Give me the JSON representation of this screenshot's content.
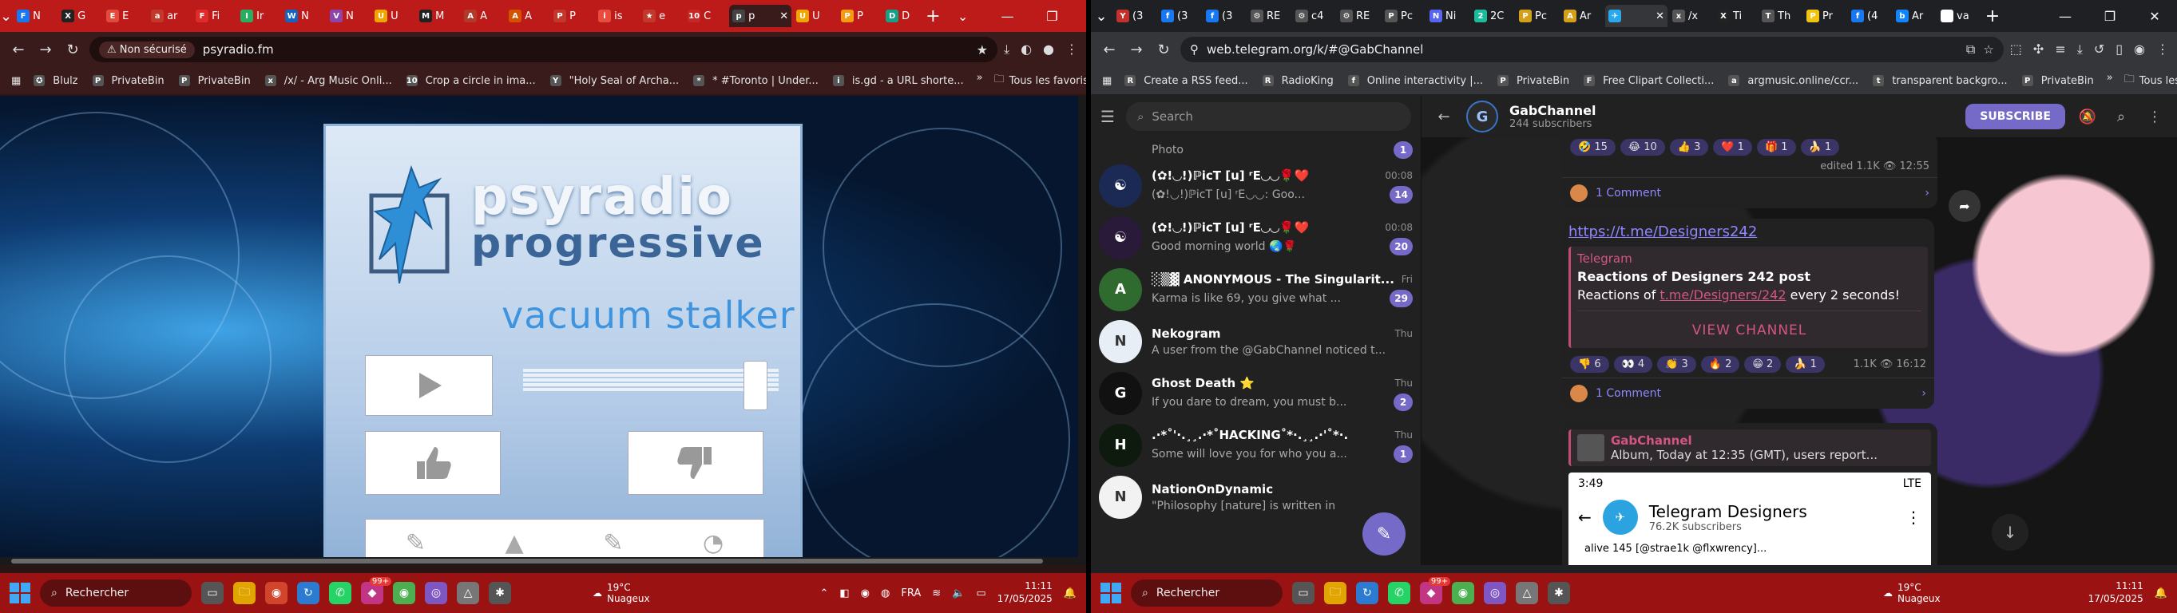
{
  "left": {
    "tabs": [
      {
        "label": "N",
        "fav": "F",
        "color": "#1877f2"
      },
      {
        "label": "G",
        "fav": "X",
        "color": "#222"
      },
      {
        "label": "E",
        "fav": "E",
        "color": "#e24a3b"
      },
      {
        "label": "ar",
        "fav": "a",
        "color": "#c0392b"
      },
      {
        "label": "Fi",
        "fav": "F",
        "color": "#e02b2b"
      },
      {
        "label": "Ir",
        "fav": "I",
        "color": "#27ae60"
      },
      {
        "label": "N",
        "fav": "W",
        "color": "#1565c0"
      },
      {
        "label": "N",
        "fav": "V",
        "color": "#8e44ad"
      },
      {
        "label": "U",
        "fav": "U",
        "color": "#f1a500"
      },
      {
        "label": "M",
        "fav": "M",
        "color": "#222"
      },
      {
        "label": "A",
        "fav": "A",
        "color": "#b23a2b"
      },
      {
        "label": "A",
        "fav": "A",
        "color": "#d35400"
      },
      {
        "label": "P",
        "fav": "P",
        "color": "#c0392b"
      },
      {
        "label": "is",
        "fav": "i",
        "color": "#e74c3c"
      },
      {
        "label": "e",
        "fav": "★",
        "color": "#c0392b"
      },
      {
        "label": "C",
        "fav": "10",
        "color": "#c62828"
      },
      {
        "label": "p",
        "fav": "p",
        "color": "#444"
      },
      {
        "label": "U",
        "fav": "U",
        "color": "#f1a500"
      },
      {
        "label": "P",
        "fav": "P",
        "color": "#f39c12"
      },
      {
        "label": "D",
        "fav": "D",
        "color": "#16a085"
      }
    ],
    "address": {
      "security": "Non sécurisé",
      "url": "psyradio.fm"
    },
    "bookmarks": [
      {
        "label": "Blulz",
        "fav": "✪"
      },
      {
        "label": "PrivateBin",
        "fav": "P"
      },
      {
        "label": "PrivateBin",
        "fav": "P"
      },
      {
        "label": "/x/ - Arg Music Onli...",
        "fav": "x"
      },
      {
        "label": "Crop a circle in ima...",
        "fav": "10"
      },
      {
        "label": "\"Holy Seal of Archa...",
        "fav": "Y"
      },
      {
        "label": "* #Toronto | Under...",
        "fav": "*"
      },
      {
        "label": "is.gd - a URL shorte...",
        "fav": "i"
      }
    ],
    "bookmarks_more": "»",
    "bookmarks_all": "Tous les favoris",
    "page": {
      "title1": "psyradio",
      "title2": "progressive",
      "track": "vacuum stalker",
      "volume_level": 0.95
    }
  },
  "right": {
    "tabs": [
      {
        "label": "(3",
        "fav": "Y",
        "color": "#c4302b"
      },
      {
        "label": "(3",
        "fav": "f",
        "color": "#1877f2"
      },
      {
        "label": "(3",
        "fav": "f",
        "color": "#1877f2"
      },
      {
        "label": "RE",
        "fav": "⚙",
        "color": "#555"
      },
      {
        "label": "c4",
        "fav": "⚙",
        "color": "#555"
      },
      {
        "label": "RE",
        "fav": "⚙",
        "color": "#555"
      },
      {
        "label": "Pc",
        "fav": "P",
        "color": "#555"
      },
      {
        "label": "Ni",
        "fav": "N",
        "color": "#5865f2"
      },
      {
        "label": "2C",
        "fav": "2",
        "color": "#1abc9c"
      },
      {
        "label": "Pc",
        "fav": "P",
        "color": "#d4a017"
      },
      {
        "label": "Ar",
        "fav": "A",
        "color": "#d4a017"
      },
      {
        "label": "",
        "fav": "✈",
        "color": "#29a9eb"
      },
      {
        "label": "/x",
        "fav": "x",
        "color": "#555"
      },
      {
        "label": "Ti",
        "fav": "X",
        "color": "#222"
      },
      {
        "label": "Th",
        "fav": "T",
        "color": "#555"
      },
      {
        "label": "Pr",
        "fav": "P",
        "color": "#f1c40f"
      },
      {
        "label": "(4",
        "fav": "f",
        "color": "#1877f2"
      },
      {
        "label": "Ar",
        "fav": "b",
        "color": "#1185fe"
      },
      {
        "label": "va",
        "fav": "G",
        "color": "#fff"
      }
    ],
    "address": {
      "url": "web.telegram.org/k/#@GabChannel"
    },
    "bookmarks": [
      {
        "label": "Create a RSS feed...",
        "fav": "R"
      },
      {
        "label": "RadioKing",
        "fav": "R"
      },
      {
        "label": "Online interactivity |...",
        "fav": "f"
      },
      {
        "label": "PrivateBin",
        "fav": "P"
      },
      {
        "label": "Free Clipart Collecti...",
        "fav": "F"
      },
      {
        "label": "argmusic.online/ccr...",
        "fav": "a"
      },
      {
        "label": "transparent backgro...",
        "fav": "t"
      },
      {
        "label": "PrivateBin",
        "fav": "P"
      }
    ],
    "bookmarks_more": "»",
    "bookmarks_all": "Tous les favoris",
    "telegram": {
      "search_placeholder": "Search",
      "chats": [
        {
          "name": "",
          "time": "",
          "msg": "Photo",
          "badge": "1",
          "avatar_color": "#6a4a2a",
          "short": true
        },
        {
          "name": "(✿!◡!)ℙicT [u] ʳE◡◡🌹❤️",
          "time": "00:08",
          "msg": "(✿!◡!)ℙicT [u] ʳE◡◡: Goo...",
          "badge": "14",
          "avatar_color": "#1a2a55",
          "initial": "☯"
        },
        {
          "name": "(✿!◡!)ℙicT [u] ʳE◡◡🌹❤️",
          "time": "00:08",
          "msg": "Good morning world 🌏🌹",
          "badge": "20",
          "avatar_color": "#2a1a3a",
          "initial": "☯"
        },
        {
          "name": "░▒▓ ANONYMOUS - The Singularit...",
          "time": "Fri",
          "msg": "Karma is like 69, you give what ...",
          "badge": "29",
          "avatar_color": "#2f6b2f",
          "initial": "A"
        },
        {
          "name": "Nekogram",
          "time": "Thu",
          "msg": "A user from the @GabChannel noticed t...",
          "badge": "",
          "avatar_color": "#e8eef6",
          "initial": "N"
        },
        {
          "name": "Ghost Death ⭐",
          "time": "Thu",
          "msg": "If you dare to dream, you must b...",
          "badge": "2",
          "avatar_color": "#111",
          "initial": "G"
        },
        {
          "name": ".·*˚'·.¸¸.·*˚HACKING˚*·.¸¸.·'˚*·.",
          "time": "Thu",
          "msg": "Some will love you for who you a...",
          "badge": "1",
          "avatar_color": "#0f1a0f",
          "initial": "H"
        },
        {
          "name": "NationOnDynamic",
          "time": "",
          "msg": "\"Philosophy [nature] is written in",
          "badge": "",
          "avatar_color": "#f2f2f2",
          "initial": "N"
        }
      ],
      "channel": {
        "title": "GabChannel",
        "subscribers": "244 subscribers",
        "subscribe_label": "SUBSCRIBE"
      },
      "msg1": {
        "reactions": [
          "🤣 15",
          "😂 10",
          "👍 3",
          "❤️ 1",
          "🎁 1",
          "🍌 1"
        ],
        "meta": "edited 1.1K 👁 12:55",
        "comments": "1 Comment"
      },
      "msg2": {
        "link": "https://t.me/Designers242",
        "site": "Telegram",
        "pv_title": "Reactions of Designers 242 post",
        "pv_desc_prefix": "Reactions of ",
        "pv_desc_link": "t.me/Designers/242",
        "pv_desc_suffix": " every 2 seconds!",
        "view_channel": "VIEW CHANNEL",
        "reactions": [
          "👎 6",
          "👀 4",
          "👏 3",
          "🔥 2",
          "😁 2",
          "🍌 1"
        ],
        "meta": "1.1K 👁 16:12",
        "comments": "1 Comment"
      },
      "msg3": {
        "reply_name": "GabChannel",
        "reply_text": "Album, Today at 12:35 (GMT), users report...",
        "shot_time": "3:49",
        "shot_status": "LTE",
        "shot_title": "Telegram Designers",
        "shot_subs": "76.2K subscribers",
        "shot_line": "alive 145 [@strae1k @flxwrency]..."
      }
    }
  },
  "taskbar": {
    "search": "Rechercher",
    "temp": "19°C",
    "weather": "Nuageux",
    "lang": "FRA",
    "time": "11:11",
    "date": "17/05/2025",
    "badge": "99+"
  }
}
